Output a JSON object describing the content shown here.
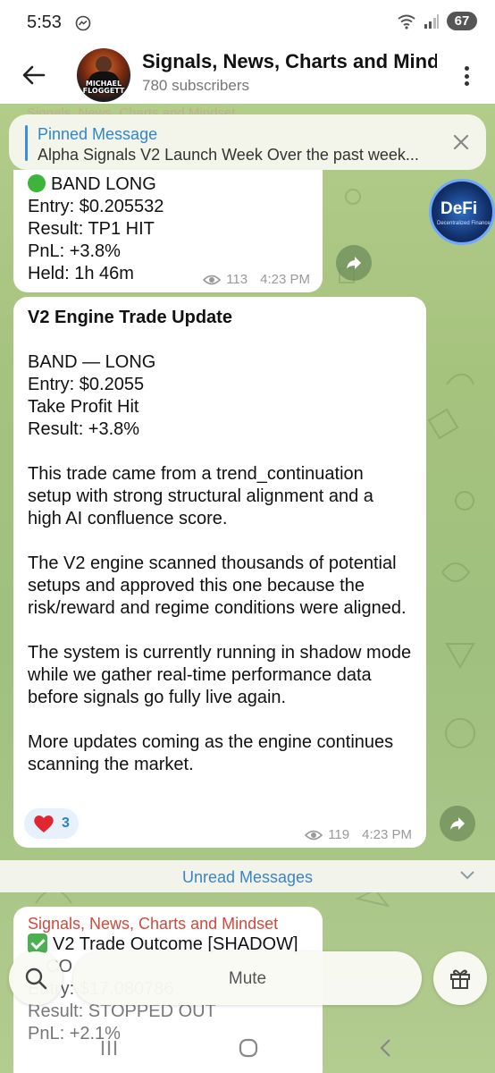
{
  "status_bar": {
    "time": "5:53",
    "battery": "67"
  },
  "header": {
    "title": "Signals, News, Charts and Mindset",
    "subscribers": "780 subscribers",
    "avatar_text": "MICHAEL\nFLOGGETT"
  },
  "background_sender": "Signals, News, Charts and Mindset",
  "pinned": {
    "title": "Pinned Message",
    "text": "Alpha Signals V2 Launch Week  Over the past week..."
  },
  "messages": [
    {
      "lines": [
        "BAND LONG",
        "Entry: $0.205532",
        "Result: TP1 HIT",
        "PnL: +3.8%",
        "Held: 1h 46m"
      ],
      "views": "113",
      "time": "4:23 PM"
    },
    {
      "title": "V2 Engine Trade Update",
      "block1": "BAND — LONG\nEntry: $0.2055\nTake Profit Hit\nResult: +3.8%",
      "para1": "This trade came from a trend_continuation setup with strong structural alignment and a high AI confluence score.",
      "para2": "The V2 engine scanned thousands of potential setups and approved this one because the risk/reward and regime conditions were aligned.",
      "para3": "The system is currently running in shadow mode while we gather real-time performance data before signals go fully live again.",
      "para4": "More updates coming as the engine continues scanning the market.",
      "reaction_count": "3",
      "views": "119",
      "time": "4:23 PM"
    },
    {
      "sender": "Signals, News, Charts and Mindset",
      "line1": "V2 Trade Outcome [SHADOW]",
      "line2": "CO",
      "line3": "Entry: $17.080786",
      "line4": "Result: STOPPED OUT",
      "line5": "PnL: +2.1%"
    }
  ],
  "defi_sticker": {
    "label": "DeFi",
    "sub": "Decentralized Finance"
  },
  "unread_label": "Unread Messages",
  "mute_label": "Mute",
  "colors": {
    "accent_blue": "#2f86d1",
    "sender_red": "#cf4a3c",
    "green_dot": "#3fb43a"
  }
}
